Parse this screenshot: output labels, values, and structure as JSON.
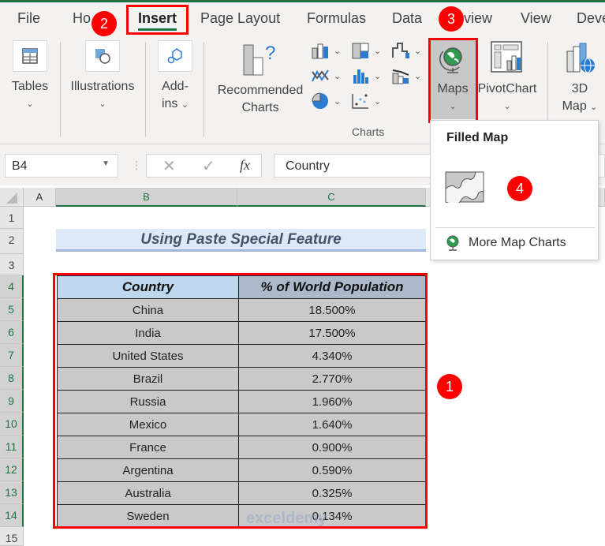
{
  "menu": {
    "tabs": [
      "File",
      "Ho",
      "Insert",
      "Page Layout",
      "Formulas",
      "Data",
      "view",
      "View",
      "Deve"
    ],
    "active_tab": "Insert"
  },
  "ribbon": {
    "tables_label": "Tables",
    "illustrations_label": "Illustrations",
    "addins_label_1": "Add-",
    "addins_label_2": "ins",
    "recommended_1": "Recommended",
    "recommended_2": "Charts",
    "charts_group": "Charts",
    "maps_label": "Maps",
    "pivotchart_label": "PivotChart",
    "map3d_label_1": "3D",
    "map3d_label_2": "Map"
  },
  "formula_bar": {
    "name_box": "B4",
    "formula": "Country",
    "fx": "fx"
  },
  "columns": [
    "A",
    "B",
    "C"
  ],
  "rows": [
    "1",
    "2",
    "3",
    "4",
    "5",
    "6",
    "7",
    "8",
    "9",
    "10",
    "11",
    "12",
    "13",
    "14",
    "15"
  ],
  "sheet": {
    "title": "Using Paste Special Feature",
    "headers": [
      "Country",
      "% of World Population"
    ],
    "data": [
      [
        "China",
        "18.500%"
      ],
      [
        "India",
        "17.500%"
      ],
      [
        "United States",
        "4.340%"
      ],
      [
        "Brazil",
        "2.770%"
      ],
      [
        "Russia",
        "1.960%"
      ],
      [
        "Mexico",
        "1.640%"
      ],
      [
        "France",
        "0.900%"
      ],
      [
        "Argentina",
        "0.590%"
      ],
      [
        "Australia",
        "0.325%"
      ],
      [
        "Sweden",
        "0.134%"
      ]
    ]
  },
  "popup": {
    "title": "Filled Map",
    "more": "More Map Charts"
  },
  "badges": [
    "1",
    "2",
    "3",
    "4"
  ],
  "watermark": "exceldemy",
  "colors": {
    "accent_green": "#217346",
    "annotation_red": "#ff0000"
  }
}
